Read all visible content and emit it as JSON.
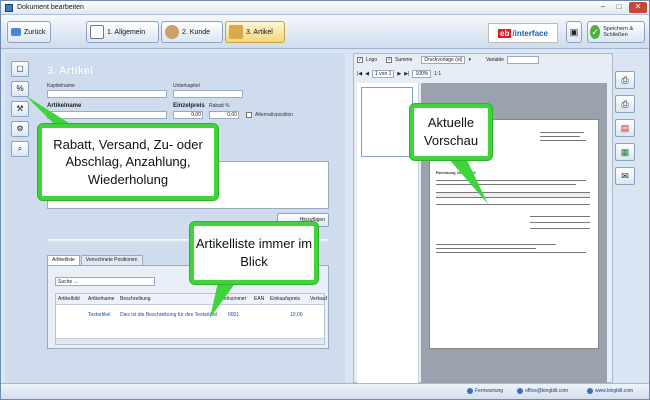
{
  "window": {
    "title": "Dokument bearbeiten"
  },
  "toolbar": {
    "back_label": "Zurück",
    "tabs": [
      {
        "label": "1. Allgemein"
      },
      {
        "label": "2. Kunde"
      },
      {
        "label": "3. Artikel"
      }
    ],
    "logo_eb": "eb",
    "logo_interface": "/interface",
    "save_close_label": "Speichern & Schließen"
  },
  "article": {
    "title": "3. Artikel",
    "fields": {
      "kapitelname": "Kapitelname",
      "unterkapitel": "Unterkapitel",
      "artikelname": "Artikelname",
      "einzelpreis": "Einzelpreis",
      "rabatt": "Rabatt %",
      "einzelpreis_value": "0,00",
      "rabatt_value": "0,00",
      "alternativ": "Alternativposition"
    },
    "add_button": "Hinzufügen"
  },
  "list": {
    "tabs": [
      "Artikelliste",
      "Verrechnete Positionen"
    ],
    "search_placeholder": "Suche ...",
    "columns": [
      "Artikelbild",
      "Artikelname",
      "Beschreibung",
      "Artikelnummer",
      "EAN",
      "Einkaufspreis",
      "Verkauf"
    ],
    "rows": [
      {
        "name": "Testartikel",
        "desc": "Dies ist die Beschreibung für den Testartikel",
        "number": "0001",
        "price": "10,00"
      }
    ]
  },
  "preview": {
    "logo_label": "Logo",
    "summe_label": "Summe",
    "template": "Druckvorlage (st)",
    "variable_label": "Variable",
    "page_label": "1 von 1",
    "zoom": "100%",
    "ratio": "1:1",
    "doc_heading": "Rechnung 2014-0001"
  },
  "callouts": {
    "rabatt": "Rabatt, Versand, Zu- oder Abschlag, Anzahlung, Wiederholung",
    "vorschau": "Aktuelle Vorschau",
    "artikelliste": "Artikelliste immer im Blick"
  },
  "status": {
    "remote": "Fernwartung",
    "email": "office@kingbill.com",
    "web": "www.kingbill.com"
  },
  "colors": {
    "accent": "#3fd43a",
    "brand_red": "#d91f26",
    "brand_blue": "#1b5ea8"
  }
}
